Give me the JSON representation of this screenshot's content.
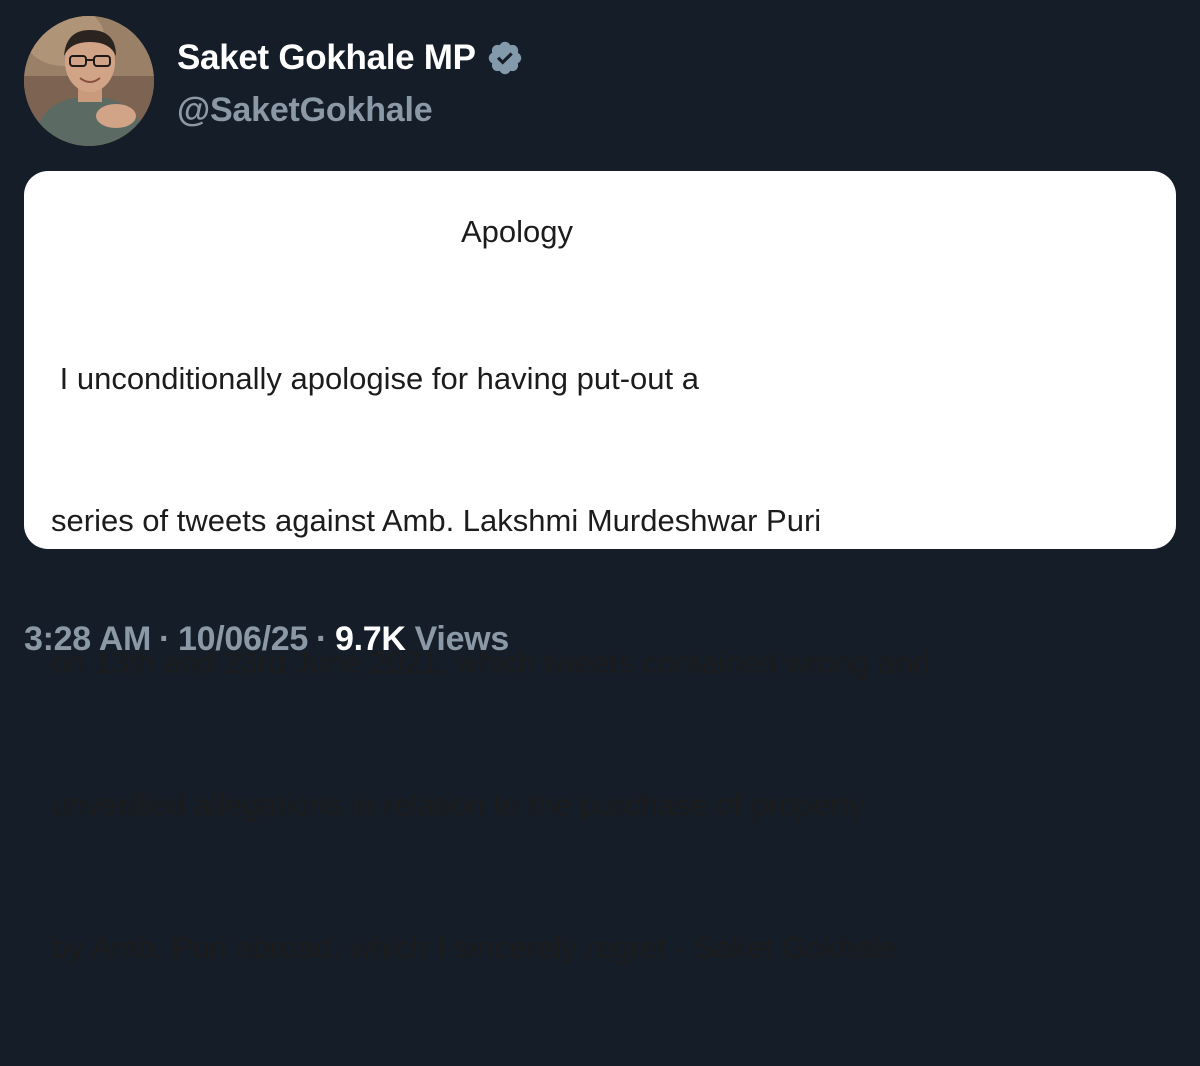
{
  "tweet": {
    "author": {
      "display_name": "Saket Gokhale MP",
      "handle": "@SaketGokhale",
      "verified_icon": "verified-badge-icon"
    },
    "media": {
      "title": "Apology",
      "lines": [
        " I unconditionally apologise for having put-out a",
        "series of tweets against Amb. Lakshmi Murdeshwar Puri",
        "on 13th and 23rd June 2021, which tweets contained wrong and",
        "unverified allegations in relation to the purchase of property",
        "by Amb. Puri abroad, which I sincerely regret - Saket Gokhale"
      ]
    },
    "meta": {
      "time": "3:28 AM",
      "separator": "·",
      "date": "10/06/25",
      "views_count": "9.7K",
      "views_label": "Views"
    }
  },
  "colors": {
    "background": "#151d28",
    "verified_badge": "#829aab",
    "secondary_text": "#8b98a5",
    "primary_text": "#ffffff"
  }
}
